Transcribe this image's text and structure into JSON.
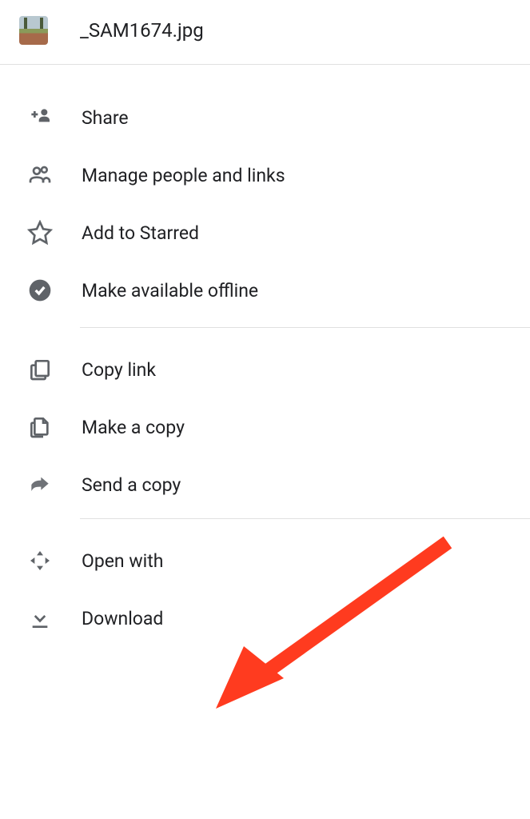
{
  "header": {
    "filename": "_SAM1674.jpg"
  },
  "menu": {
    "share": "Share",
    "manage": "Manage people and links",
    "star": "Add to Starred",
    "offline": "Make available offline",
    "copy_link": "Copy link",
    "make_copy": "Make a copy",
    "send_copy": "Send a copy",
    "open_with": "Open with",
    "download": "Download"
  }
}
